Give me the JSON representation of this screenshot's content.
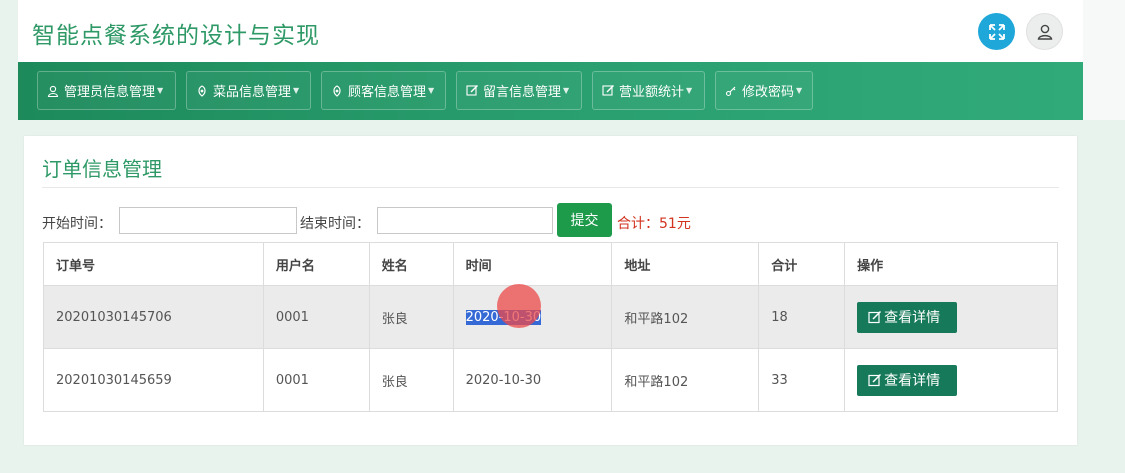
{
  "header": {
    "title": "智能点餐系统的设计与实现",
    "expand_icon": "expand-icon",
    "user_icon": "user-icon",
    "accent": "#1fa7d9"
  },
  "nav": {
    "items": [
      {
        "label": "管理员信息管理",
        "icon": "user-icon"
      },
      {
        "label": "菜品信息管理",
        "icon": "leaf-icon"
      },
      {
        "label": "顾客信息管理",
        "icon": "leaf-icon"
      },
      {
        "label": "留言信息管理",
        "icon": "edit-icon"
      },
      {
        "label": "营业额统计",
        "icon": "edit-icon"
      },
      {
        "label": "修改密码",
        "icon": "key-icon"
      }
    ],
    "color": "#1d8a5b"
  },
  "panel": {
    "title": "订单信息管理",
    "filter": {
      "start_label": "开始时间：",
      "start_value": "",
      "end_label": "结束时间：",
      "end_value": "",
      "submit_label": "提交",
      "total_text": "合计：51元"
    }
  },
  "table": {
    "headers": [
      "订单号",
      "用户名",
      "姓名",
      "时间",
      "地址",
      "合计",
      "操作"
    ],
    "rows": [
      {
        "order_no": "20201030145706",
        "username": "0001",
        "name": "张良",
        "date": "2020-10-30",
        "address": "和平路102",
        "total": "18",
        "action": "查看详情"
      },
      {
        "order_no": "20201030145659",
        "username": "0001",
        "name": "张良",
        "date": "2020-10-30",
        "address": "和平路102",
        "total": "33",
        "action": "查看详情"
      }
    ]
  }
}
